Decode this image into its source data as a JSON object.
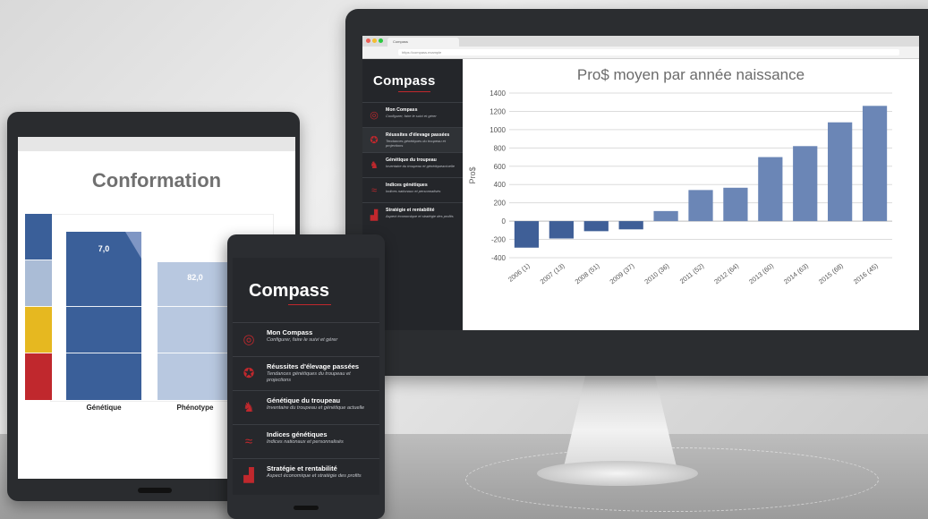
{
  "colors": {
    "brand_red": "#c0282d",
    "bar_blue": "#6b86b6",
    "dark_blue": "#3a5f99",
    "light_blue": "#aabcd6",
    "yellow": "#e6b820"
  },
  "desktop": {
    "browser": {
      "tab_label": "Compass",
      "url": "https://compass.example"
    },
    "logo": "Compass",
    "sidebar": [
      {
        "icon": "compass-icon",
        "title": "Mon Compass",
        "subtitle": "Configurer, faire le suivi et gérer"
      },
      {
        "icon": "award-icon",
        "title": "Réussites d'élevage passées",
        "subtitle": "Tendances génétiques du troupeau et projections"
      },
      {
        "icon": "cow-icon",
        "title": "Génétique du troupeau",
        "subtitle": "Inventaire du troupeau et génétiqueactuelle"
      },
      {
        "icon": "dna-icon",
        "title": "Indices génétiques",
        "subtitle": "Indices nationaux et personnalisés"
      },
      {
        "icon": "growth-chart-icon",
        "title": "Stratégie et rentabilité",
        "subtitle": "Aspect économique et stratégie des profits"
      }
    ]
  },
  "chart_data": {
    "type": "bar",
    "title": "Pro$ moyen par année naissance",
    "ylabel": "Pro$",
    "xlabel": "",
    "ylim": [
      -400,
      1400
    ],
    "yticks": [
      -400,
      -200,
      0,
      200,
      400,
      600,
      800,
      1000,
      1200,
      1400
    ],
    "grid": true,
    "categories": [
      "2006 (1)",
      "2007 (13)",
      "2008 (51)",
      "2009 (37)",
      "2010 (36)",
      "2011 (52)",
      "2012 (64)",
      "2013 (60)",
      "2014 (63)",
      "2015 (68)",
      "2016 (45)"
    ],
    "values": [
      -290,
      -190,
      -110,
      -90,
      110,
      340,
      365,
      700,
      820,
      1080,
      1260
    ]
  },
  "tablet": {
    "title": "Conformation",
    "bars": [
      {
        "label": "Génétique",
        "value_label": "7,0"
      },
      {
        "label": "Phénotype",
        "value_label": "82,0"
      }
    ]
  },
  "phone": {
    "logo": "Compass",
    "items": [
      {
        "icon": "compass-icon",
        "title": "Mon Compass",
        "subtitle": "Configurer, faire le suivi et gérer"
      },
      {
        "icon": "award-icon",
        "title": "Réussites d'élevage passées",
        "subtitle": "Tendances génétiques du troupeau et projections"
      },
      {
        "icon": "cow-icon",
        "title": "Génétique du troupeau",
        "subtitle": "Inventaire du troupeau et génétique actuelle"
      },
      {
        "icon": "dna-icon",
        "title": "Indices génétiques",
        "subtitle": "Indices nationaux et personnalisés"
      },
      {
        "icon": "growth-chart-icon",
        "title": "Stratégie et rentabilité",
        "subtitle": "Aspect économique et stratégie des profits"
      }
    ]
  }
}
